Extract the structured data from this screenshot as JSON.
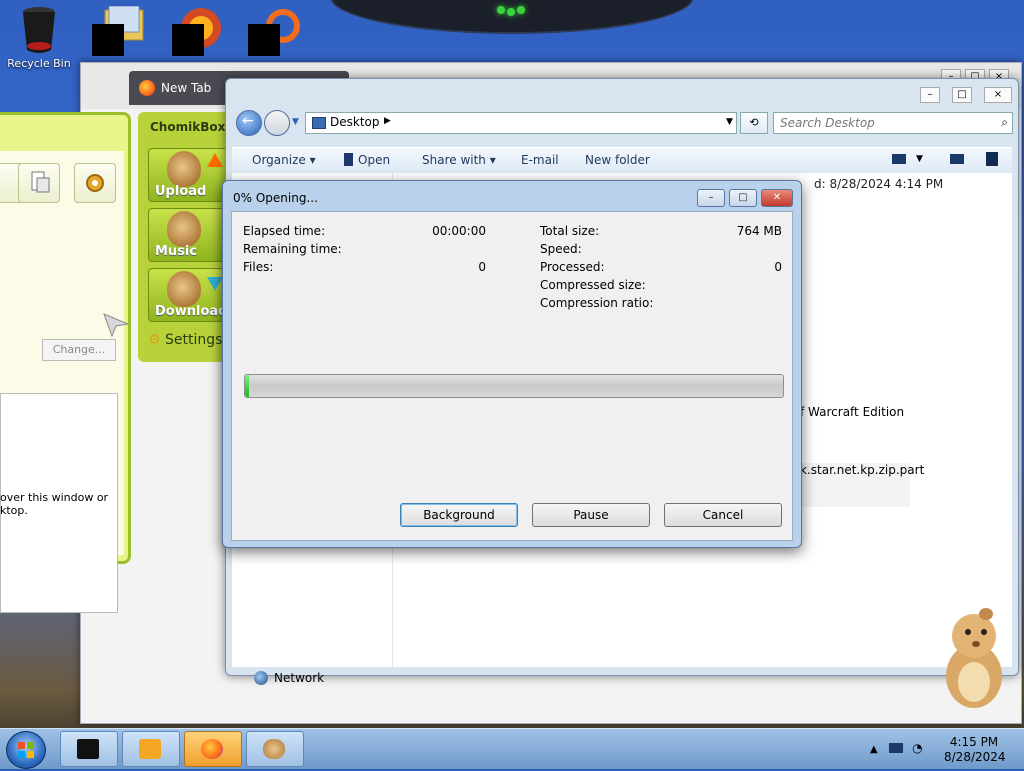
{
  "desktop": {
    "recycle_bin_label": "Recycle Bin"
  },
  "browser": {
    "tab_title": "New Tab"
  },
  "chomikbox": {
    "title": "ChomikBox",
    "change_label": "Change...",
    "hint_line1": "over this window or",
    "hint_line2": "ktop.",
    "buttons": [
      {
        "label": "Upload"
      },
      {
        "label": "Music"
      },
      {
        "label": "Download"
      }
    ],
    "settings_label": "Settings"
  },
  "explorer": {
    "address": "Desktop",
    "search_placeholder": "Search Desktop",
    "toolbar": {
      "organize": "Organize",
      "open": "Open",
      "share_with": "Share with",
      "email": "E-mail",
      "new_folder": "New folder"
    },
    "detail_date": "d: 8/28/2024 4:14 PM",
    "file1": "f Warcraft Edition",
    "file2": "k.star.net.kp.zip.part",
    "network": "Network"
  },
  "dialog": {
    "title": "0% Opening...",
    "elapsed_label": "Elapsed time:",
    "elapsed_value": "00:00:00",
    "remaining_label": "Remaining time:",
    "files_label": "Files:",
    "files_value": "0",
    "total_size_label": "Total size:",
    "total_size_value": "764 MB",
    "speed_label": "Speed:",
    "processed_label": "Processed:",
    "processed_value": "0",
    "compressed_label": "Compressed size:",
    "ratio_label": "Compression ratio:",
    "progress_fraction": 0.008,
    "buttons": {
      "background": "Background",
      "pause": "Pause",
      "cancel": "Cancel"
    }
  },
  "taskbar": {
    "time": "4:15 PM",
    "date": "8/28/2024"
  },
  "icons": {
    "start": "windows-start-icon",
    "firefox": "firefox-icon",
    "folder": "folder-icon",
    "search": "search-icon",
    "network": "network-icon"
  }
}
